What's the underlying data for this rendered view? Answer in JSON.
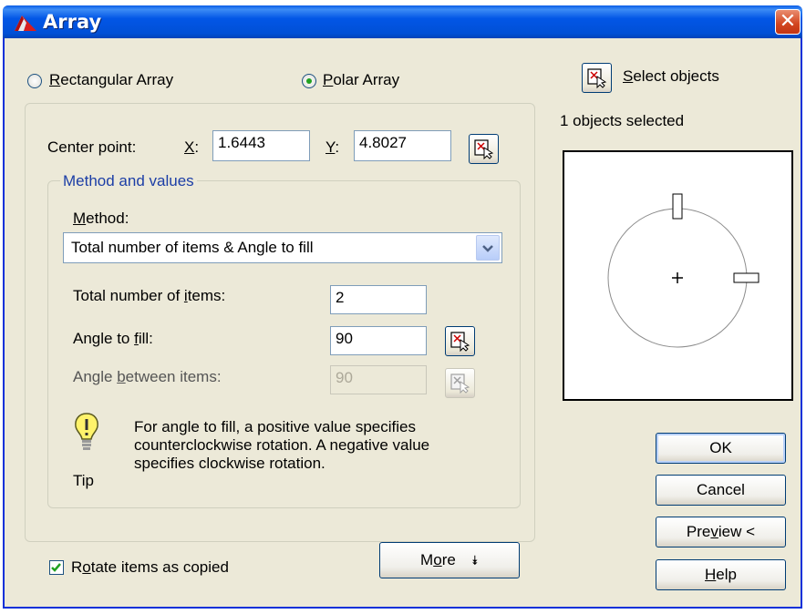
{
  "window": {
    "title": "Array",
    "close_glyph": "✕"
  },
  "array_type": {
    "rectangular": {
      "prefix": "",
      "hot": "R",
      "rest": "ectangular Array",
      "selected": false
    },
    "polar": {
      "prefix": "",
      "hot": "P",
      "rest": "olar Array",
      "selected": true
    }
  },
  "center_point": {
    "label": "Center point:",
    "x_hot": "X",
    "x_rest": ":",
    "x_value": "1.6443",
    "y_hot": "Y",
    "y_rest": ":",
    "y_value": "4.8027"
  },
  "method_group": {
    "legend": "Method and values",
    "method_hot": "M",
    "method_rest": "ethod:",
    "method_value": "Total number of items & Angle to fill",
    "total_items": {
      "pre": "Total number of ",
      "hot": "i",
      "post": "tems:",
      "value": "2"
    },
    "angle_fill": {
      "pre": "Angle to ",
      "hot": "f",
      "post": "ill:",
      "value": "90"
    },
    "angle_between": {
      "pre": "Angle ",
      "hot": "b",
      "post": "etween items:",
      "value": "90",
      "disabled": true
    }
  },
  "tip": {
    "label": "Tip",
    "lines": [
      "For angle to fill, a positive value specifies",
      "counterclockwise rotation.  A negative value",
      "specifies clockwise rotation."
    ]
  },
  "rotate_items": {
    "pre": "R",
    "hot": "o",
    "post": "tate items as copied",
    "checked": true
  },
  "more_button": {
    "pre": "M",
    "hot": "o",
    "post": "re",
    "glyph": "⯯"
  },
  "select_objects": {
    "hot": "S",
    "rest": "elect objects",
    "status": "1 objects selected"
  },
  "buttons": {
    "ok": "OK",
    "cancel": "Cancel",
    "preview_pre": "Pre",
    "preview_hot": "v",
    "preview_post": "iew <",
    "help_hot": "H",
    "help_rest": "elp"
  },
  "colors": {
    "title_bar": "#0256e6",
    "dialog_bg": "#ece9d8",
    "legend_text": "#1c3ea6",
    "radio_dot": "#21a121"
  }
}
